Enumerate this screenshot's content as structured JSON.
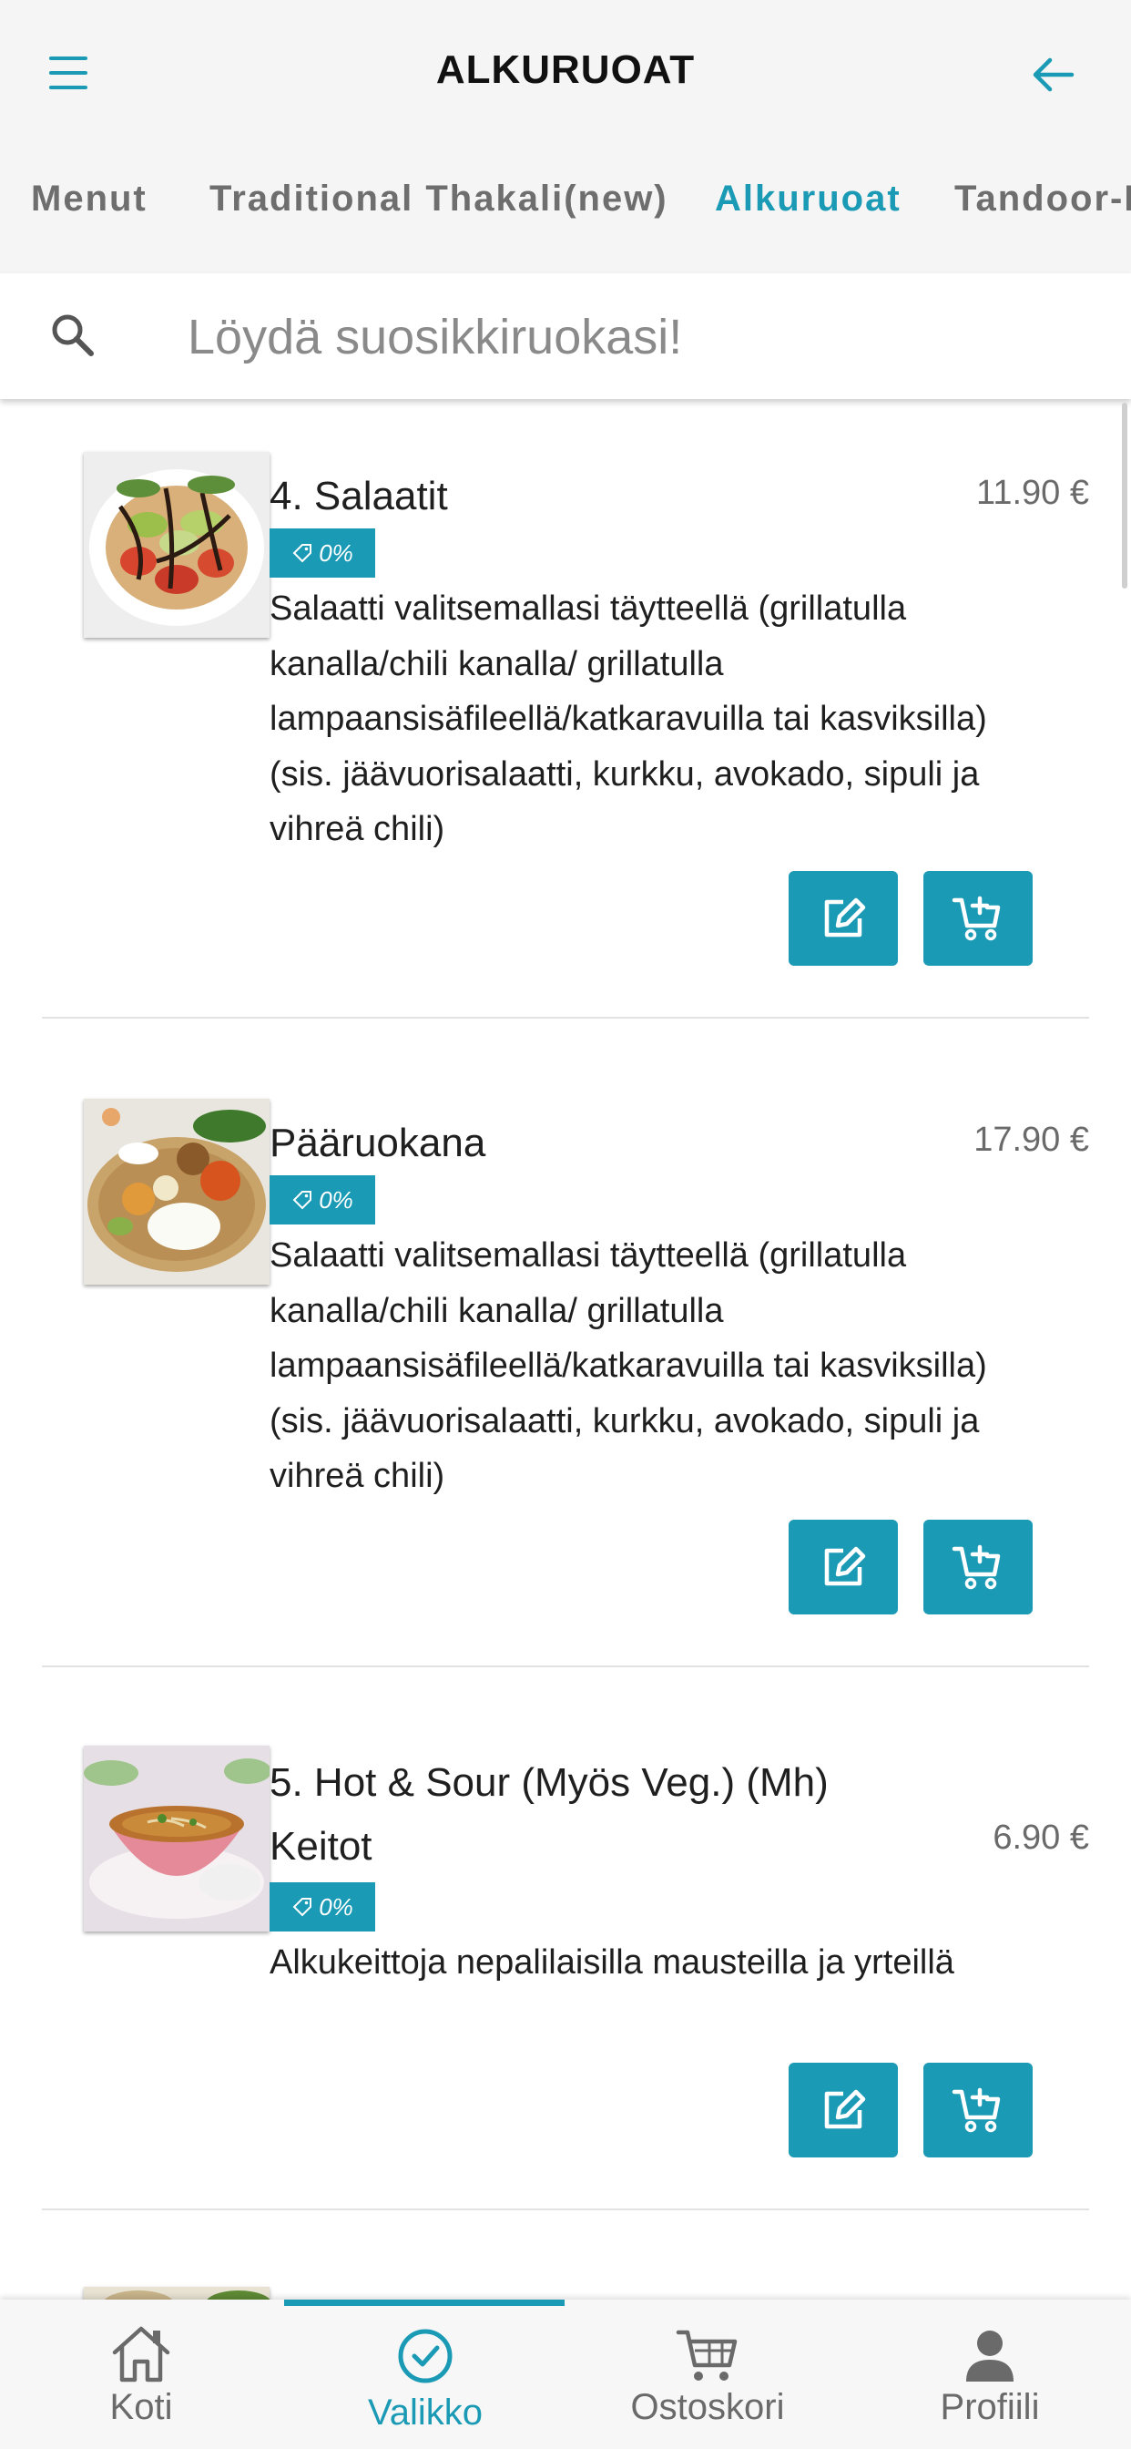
{
  "header": {
    "title": "ALKURUOAT"
  },
  "tabs": [
    "Menut",
    "Traditional Thakali(new)",
    "Alkuruoat",
    "Tandoor-R"
  ],
  "active_tab_index": 2,
  "search": {
    "placeholder": "Löydä suosikkiruokasi!",
    "value": ""
  },
  "items": [
    {
      "name": "4. Salaatit",
      "price": "11.90 €",
      "discount": "0%",
      "description": "Salaatti valitsemallasi täytteellä (grillatulla kanalla/chili kanalla/ grillatulla lampaansisäfileellä/katkaravuilla tai kasviksilla) (sis. jäävuorisalaatti, kurkku, avokado, sipuli ja vihreä chili)"
    },
    {
      "name": "Pääruokana",
      "price": "17.90 €",
      "discount": "0%",
      "description": "Salaatti valitsemallasi täytteellä (grillatulla kanalla/chili kanalla/ grillatulla lampaansisäfileellä/katkaravuilla tai kasviksilla) (sis. jäävuorisalaatti, kurkku, avokado, sipuli ja vihreä chili)"
    },
    {
      "name": "5. Hot & Sour (Myös Veg.) (Mh) Keitot",
      "price": "6.90 €",
      "discount": "0%",
      "description": "Alkukeittoja nepalilaisilla mausteilla ja yrteillä"
    }
  ],
  "bottom_nav": [
    {
      "label": "Koti",
      "icon": "home-icon"
    },
    {
      "label": "Valikko",
      "icon": "check-circle-icon"
    },
    {
      "label": "Ostoskori",
      "icon": "cart-icon"
    },
    {
      "label": "Profiili",
      "icon": "person-icon"
    }
  ],
  "active_nav_index": 1,
  "colors": {
    "accent": "#1a9ab5",
    "header_bg": "#f5f5f5",
    "text": "#1f1f1f",
    "muted": "#6a6a6a"
  }
}
